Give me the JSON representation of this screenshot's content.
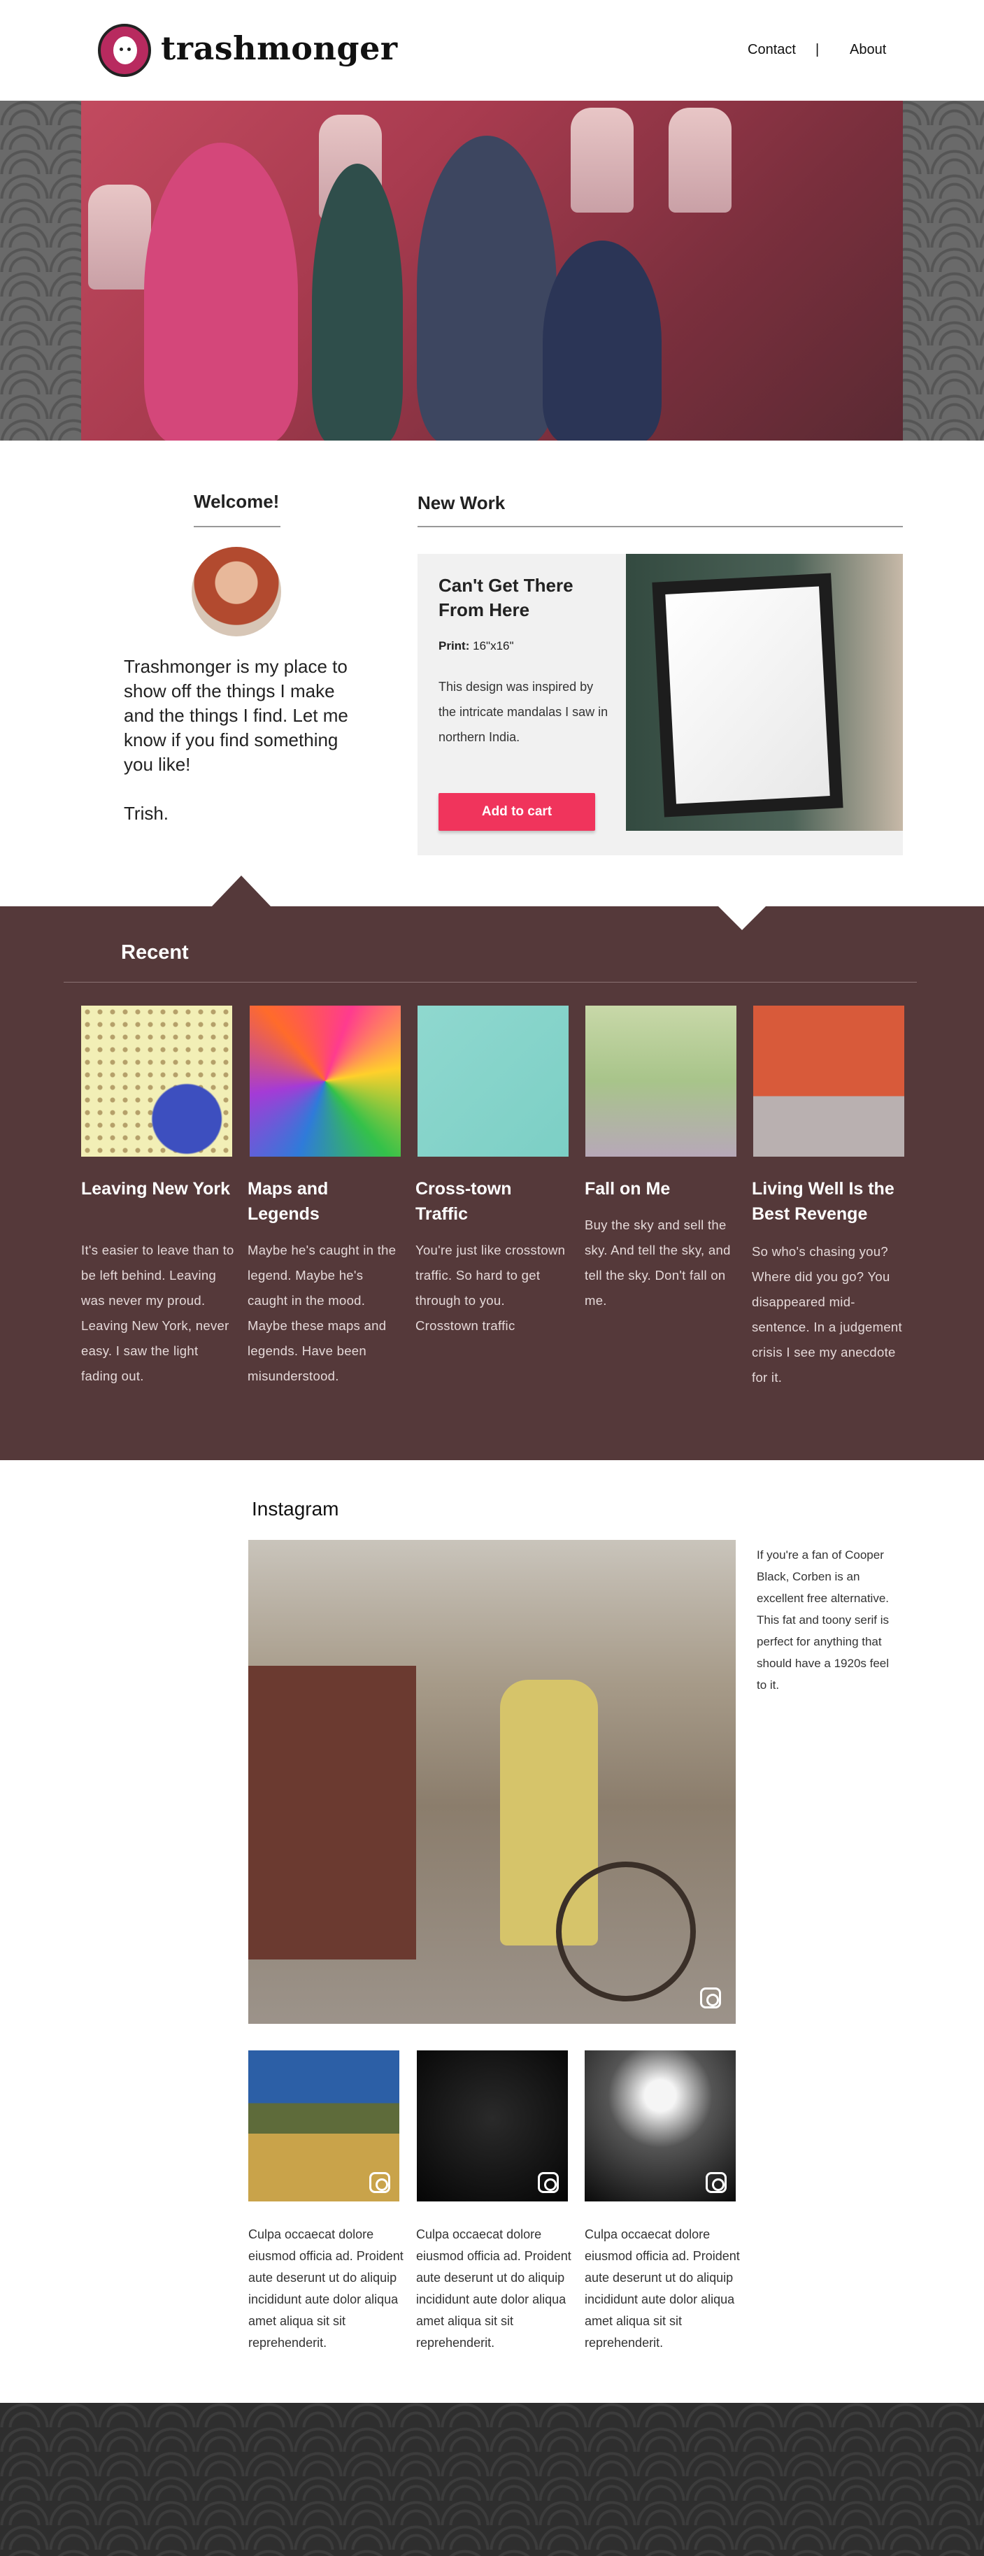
{
  "header": {
    "brand": "trashmonger",
    "nav": [
      "Contact",
      "About"
    ],
    "separator": "|"
  },
  "welcome": {
    "heading": "Welcome!",
    "text": "Trashmonger is my place to show off the things I make and the things I find. Let me know if you find something you like!",
    "signature": "Trish."
  },
  "new_work": {
    "heading": "New Work",
    "title": "Can't Get There From Here",
    "print_label": "Print:",
    "print_value": "16\"x16\"",
    "description": "This design was inspired by the intricate mandalas I saw in northern India.",
    "cart_button": "Add to cart"
  },
  "recent": {
    "heading": "Recent",
    "items": [
      {
        "title": "Leaving New York",
        "text": "It's easier to leave than to be left behind. Leaving was never my proud. Leaving New York, never easy. I saw the light fading out."
      },
      {
        "title": "Maps and Legends",
        "text": "Maybe he's caught in the legend. Maybe he's caught in the mood. Maybe these maps and legends. Have been misunderstood."
      },
      {
        "title": "Cross-town Traffic",
        "text": "You're just like crosstown traffic. So hard to get through to you. Crosstown traffic"
      },
      {
        "title": "Fall on Me",
        "text": "Buy the sky and sell the sky. And tell the sky, and tell the sky. Don't fall on me."
      },
      {
        "title": "Living Well Is the Best Revenge",
        "text": "So who's chasing you? Where did you go? You disappeared mid-sentence. In a judgement crisis I see my anecdote for it."
      }
    ]
  },
  "instagram": {
    "heading": "Instagram",
    "note": "If you're a fan of Cooper Black, Corben is an excellent free alternative. This fat and toony serif is perfect for anything that should have a 1920s feel to it.",
    "captions": [
      "Culpa occaecat dolore eiusmod officia ad. Proident aute deserunt ut do aliquip incididunt aute dolor aliqua amet aliqua sit sit reprehenderit.",
      "Culpa occaecat dolore eiusmod officia ad. Proident aute deserunt ut do aliquip incididunt aute dolor aliqua amet aliqua sit sit reprehenderit.",
      "Culpa occaecat dolore eiusmod officia ad. Proident aute deserunt ut do aliquip incididunt aute dolor aliqua amet aliqua sit sit reprehenderit."
    ]
  },
  "colors": {
    "accent": "#f0345c",
    "recent_bg": "#55393a",
    "logo": "#b82a5f",
    "footer": "#2e2e2e"
  },
  "icons": [
    "logo-face-icon",
    "instagram-icon"
  ]
}
